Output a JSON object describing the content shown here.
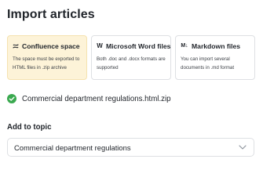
{
  "page": {
    "title": "Import articles"
  },
  "sources": [
    {
      "title": "Confluence space",
      "icon": "confluence-icon",
      "description": "The space must be exported to HTML files in .zip archive",
      "selected": true
    },
    {
      "title": "Microsoft Word files",
      "icon": "word-icon",
      "icon_glyph": "W",
      "description": "Both .doc and .docx formats are supported",
      "selected": false
    },
    {
      "title": "Markdown files",
      "icon": "markdown-icon",
      "icon_glyph": "M↓",
      "description": "You can import several documents in .md format",
      "selected": false
    }
  ],
  "uploaded_file": {
    "name": "Commercial department regulations.html.zip",
    "status_icon": "success-check-icon",
    "status_color": "#3aa94f"
  },
  "add_to_topic": {
    "label": "Add to topic",
    "selected_value": "Commercial department regulations"
  },
  "colors": {
    "selected_card_bg": "#fdf3d8",
    "border": "#dee0e3",
    "text": "#1f2329"
  }
}
